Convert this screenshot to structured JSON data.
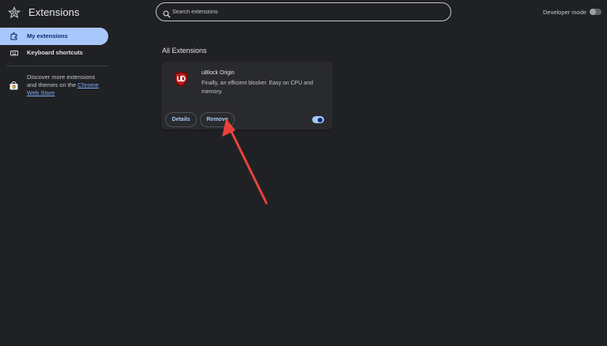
{
  "app": {
    "title": "Extensions"
  },
  "sidebar": {
    "items": [
      {
        "label": "My extensions",
        "icon": "extension-icon",
        "active": true
      },
      {
        "label": "Keyboard shortcuts",
        "icon": "keyboard-icon",
        "active": false
      }
    ],
    "discover_text": "Discover more extensions and themes on the ",
    "discover_link": "Chrome Web Store"
  },
  "search": {
    "placeholder": "Search extensions",
    "value": ""
  },
  "developer_mode": {
    "label": "Developer mode",
    "enabled": false
  },
  "main": {
    "section_title": "All Extensions",
    "extensions": [
      {
        "name": "uBlock Origin",
        "description": "Finally, an efficient blocker. Easy on CPU and memory.",
        "details_label": "Details",
        "remove_label": "Remove",
        "enabled": true,
        "icon": "ublock-origin-icon"
      }
    ]
  },
  "annotation": {
    "type": "red-arrow",
    "points_to": "remove-button",
    "color": "#e8423b"
  },
  "colors": {
    "background": "#202124",
    "card": "#292a2d",
    "accent": "#a8c7fa",
    "active_nav_text": "#062e6f"
  }
}
